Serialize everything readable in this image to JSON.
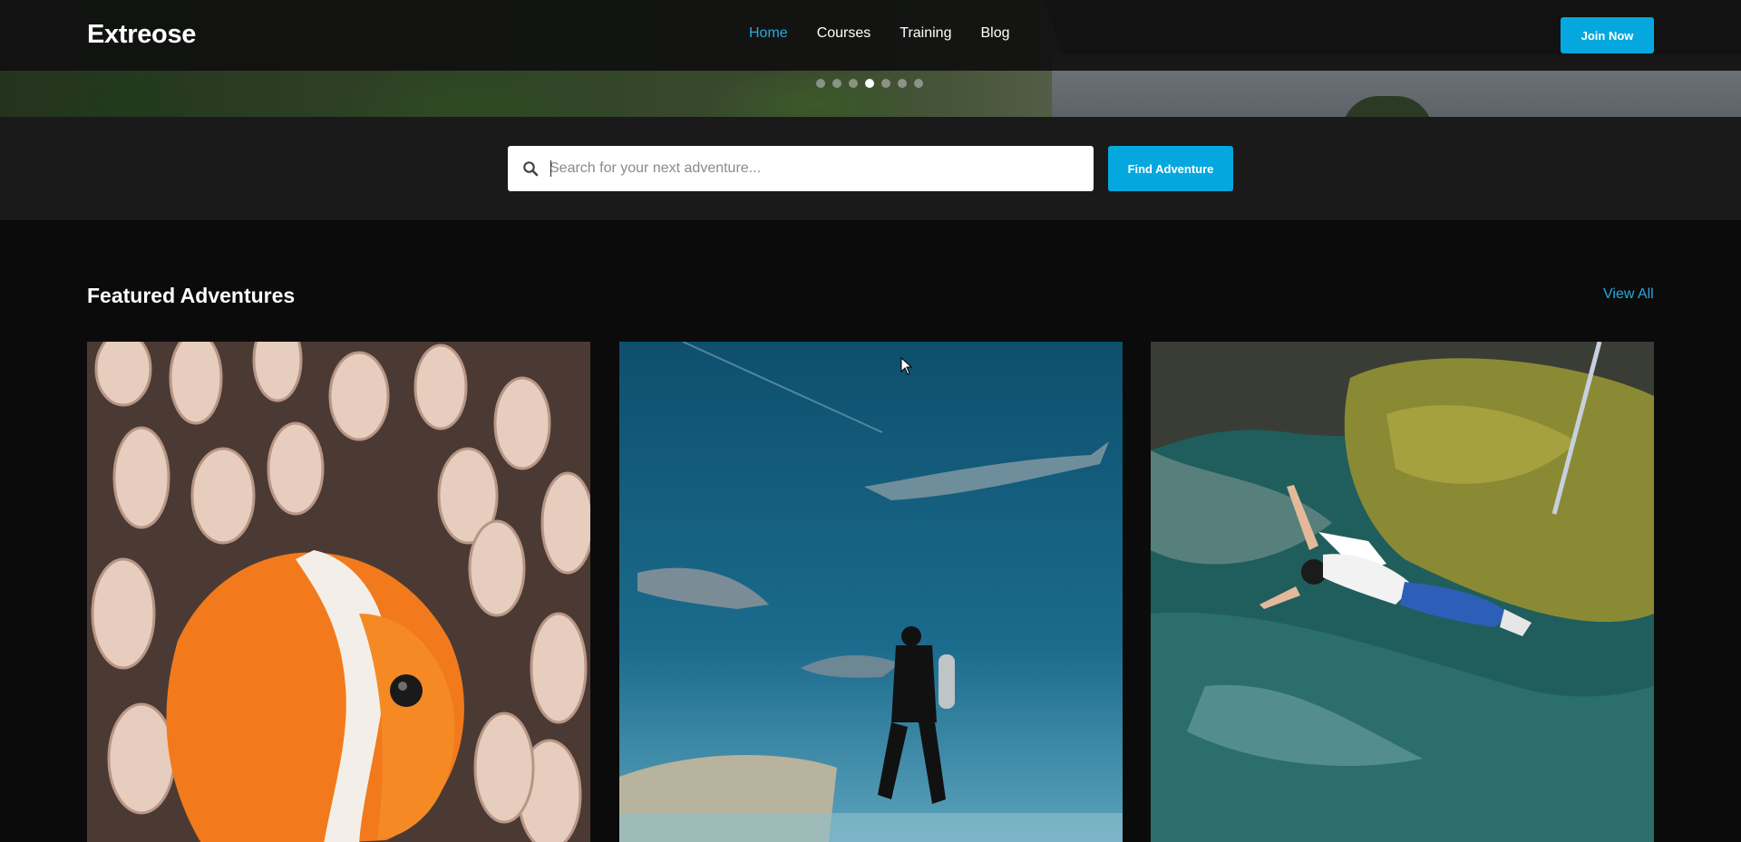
{
  "brand": {
    "name": "Extreose"
  },
  "nav": {
    "items": [
      {
        "label": "Home",
        "active": true
      },
      {
        "label": "Courses",
        "active": false
      },
      {
        "label": "Training",
        "active": false
      },
      {
        "label": "Blog",
        "active": false
      }
    ],
    "cta_label": "Join Now"
  },
  "hero": {
    "slides_total": 7,
    "active_slide": 4
  },
  "search": {
    "placeholder": "Search for your next adventure...",
    "value": "",
    "button_label": "Find Adventure"
  },
  "featured": {
    "title": "Featured Adventures",
    "view_all_label": "View All",
    "cards": [
      {
        "image": "clownfish-anemone-photo"
      },
      {
        "image": "scuba-diver-sharks-photo"
      },
      {
        "image": "bungee-jump-over-water-photo"
      }
    ]
  },
  "colors": {
    "accent": "#05a8de",
    "link": "#29a8df",
    "background": "#0b0b0b",
    "band": "#1a1a1a"
  }
}
